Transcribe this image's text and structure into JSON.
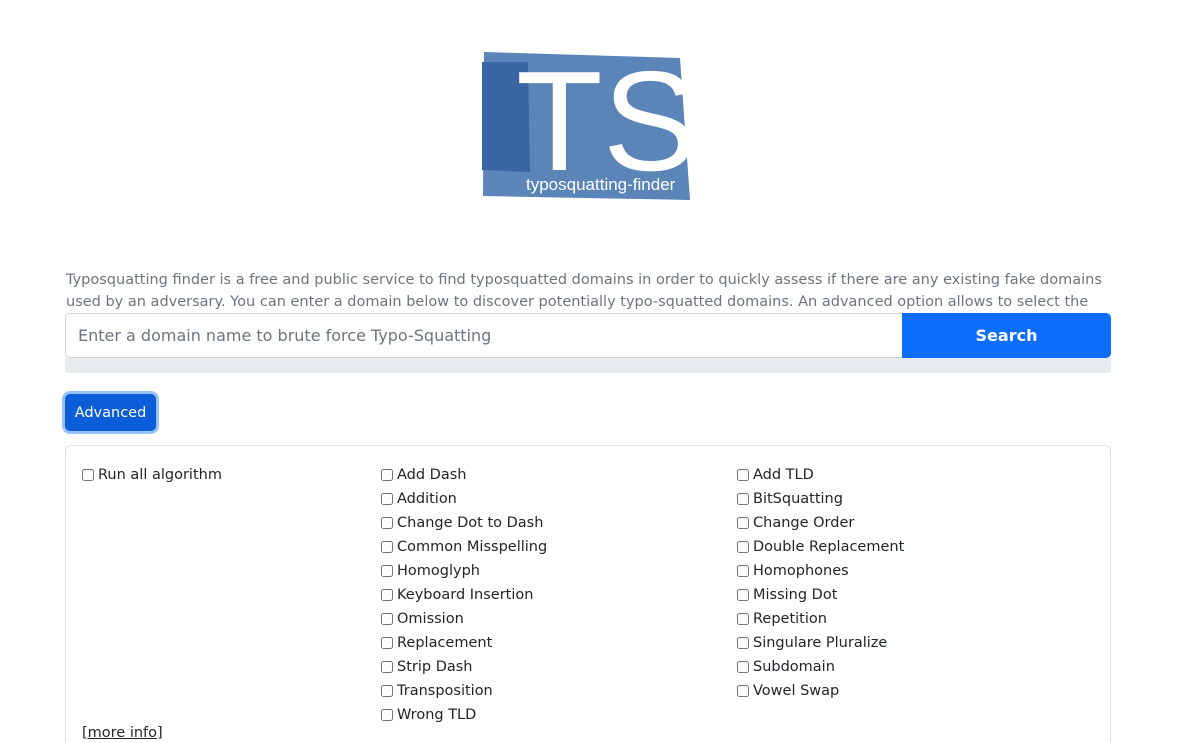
{
  "brand": {
    "logo_letters": "TS",
    "logo_caption": "typosquatting-finder",
    "logo_color": "#3f6ea9"
  },
  "intro_text": "Typosquatting finder is a free and public service to find typosquatted domains in order to quickly assess if there are any existing fake domains used by an adversary. You can enter a domain below to discover potentially typo-squatted domains. An advanced option allows to select the algorithms used.",
  "search": {
    "placeholder": "Enter a domain name to brute force Typo-Squatting",
    "value": "",
    "button_label": "Search",
    "progress_percent": 0
  },
  "advanced_label": "Advanced",
  "algorithms": {
    "run_all_label": "Run all algorithm",
    "column_a": [
      "Add Dash",
      "Addition",
      "Change Dot to Dash",
      "Common Misspelling",
      "Homoglyph",
      "Keyboard Insertion",
      "Omission",
      "Replacement",
      "Strip Dash",
      "Transposition",
      "Wrong TLD"
    ],
    "column_b": [
      "Add TLD",
      "BitSquatting",
      "Change Order",
      "Double Replacement",
      "Homophones",
      "Missing Dot",
      "Repetition",
      "Singulare Pluralize",
      "Subdomain",
      "Vowel Swap"
    ],
    "more_info_label": "[more info]"
  },
  "colors": {
    "primary": "#0d6efd",
    "primary_active": "#0b5ed7",
    "muted_text": "#6c757d"
  }
}
